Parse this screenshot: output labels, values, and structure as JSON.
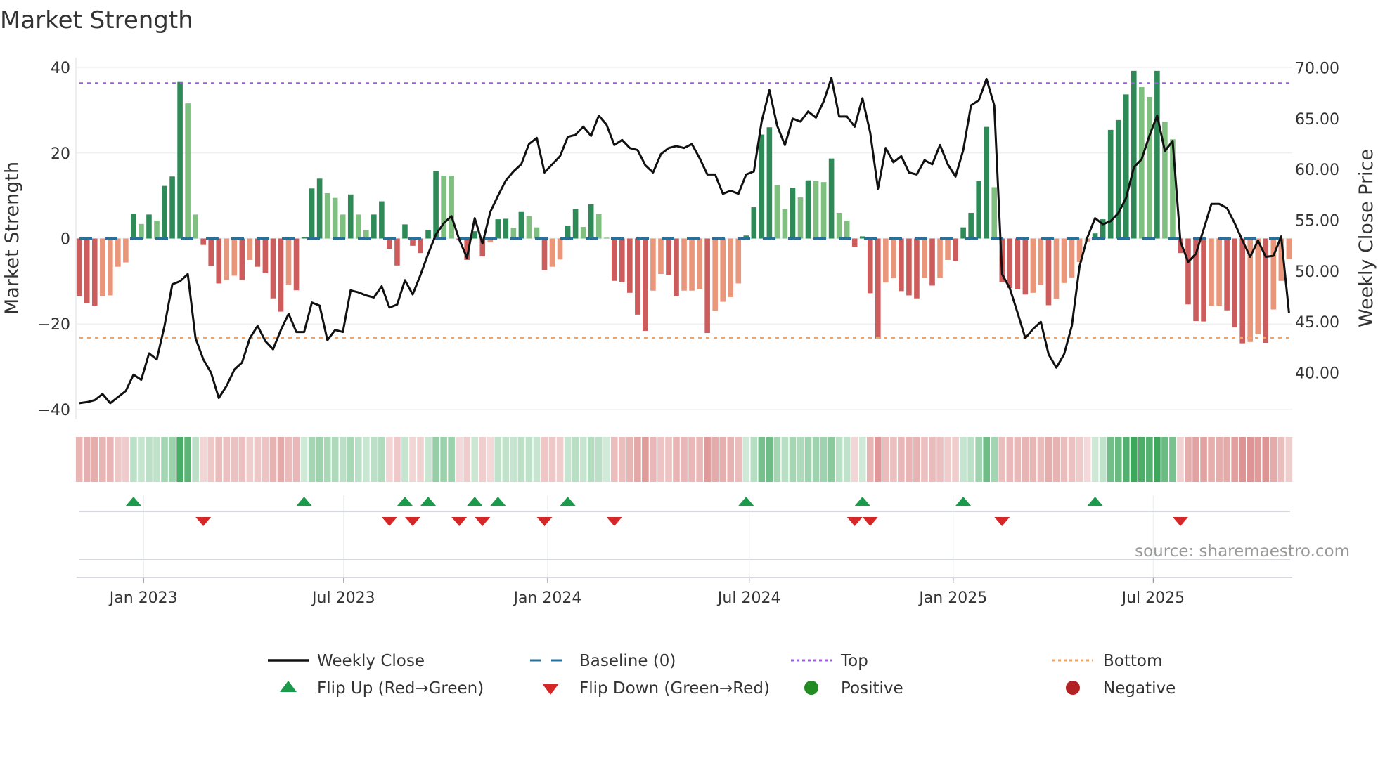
{
  "title": "Market Strength",
  "source": "source: sharemaestro.com",
  "colors": {
    "bar_pos_strong": "#2e8b57",
    "bar_pos_weak": "#7fbf7f",
    "bar_neg_strong": "#cd5c5c",
    "bar_neg_weak": "#e9967a",
    "baseline": "#2a6f97",
    "top": "#9b5de5",
    "bottom": "#f4a261",
    "line": "#111111",
    "flip_up": "#1a9a4a",
    "flip_down": "#d62728",
    "positive": "#228b22",
    "negative": "#b22222"
  },
  "legend": [
    {
      "label": "Weekly Close",
      "icon": "solid-line"
    },
    {
      "label": "Baseline (0)",
      "icon": "dashed-line"
    },
    {
      "label": "Top",
      "icon": "dotted-line"
    },
    {
      "label": "Bottom",
      "icon": "dotted-line"
    },
    {
      "label": "Flip Up (Red→Green)",
      "icon": "triangle-up"
    },
    {
      "label": "Flip Down (Green→Red)",
      "icon": "triangle-down"
    },
    {
      "label": "Positive",
      "icon": "circle"
    },
    {
      "label": "Negative",
      "icon": "circle"
    }
  ],
  "chart_data": {
    "type": "bar",
    "title": "Market Strength",
    "ylabel": "Market Strength",
    "y2label": "Weekly Close Price",
    "ylim": [
      -42.3,
      42.3
    ],
    "y2lim": [
      35.4,
      71.0
    ],
    "yticks": [
      "40",
      "20",
      "0",
      "−20",
      "−40"
    ],
    "ytick_values": [
      40,
      20,
      0,
      -20,
      -40
    ],
    "y2ticks": [
      "70.00",
      "65.00",
      "60.00",
      "55.00",
      "50.00",
      "45.00",
      "40.00"
    ],
    "y2tick_values": [
      70,
      65,
      60,
      55,
      50,
      45,
      40
    ],
    "xticks": [
      {
        "label": "Jan 2023",
        "week": 8.3
      },
      {
        "label": "Jul 2023",
        "week": 34.1
      },
      {
        "label": "Jan 2024",
        "week": 60.4
      },
      {
        "label": "Jul 2024",
        "week": 86.4
      },
      {
        "label": "Jan 2025",
        "week": 112.7
      },
      {
        "label": "Jul 2025",
        "week": 138.5
      }
    ],
    "top_level": 36.3,
    "bottom_level": -23.2,
    "baseline": 0,
    "strength": [
      -13.5,
      -15.2,
      -15.7,
      -13.5,
      -13.3,
      -6.6,
      -5.6,
      5.8,
      3.4,
      5.6,
      4.2,
      12.3,
      14.5,
      36.6,
      31.6,
      5.6,
      -1.5,
      -6.4,
      -10.5,
      -9.7,
      -8.7,
      -9.7,
      -5.0,
      -6.6,
      -8.1,
      -14.0,
      -17.1,
      -10.9,
      -12.1,
      0.4,
      11.7,
      14.0,
      10.6,
      9.5,
      5.6,
      10.3,
      5.6,
      2.0,
      5.6,
      8.7,
      -2.4,
      -6.3,
      3.3,
      -1.7,
      -3.4,
      2.0,
      15.8,
      14.7,
      14.7,
      -0.3,
      -5.0,
      1.7,
      -4.2,
      -0.9,
      4.5,
      4.6,
      2.5,
      6.2,
      5.2,
      2.6,
      -7.4,
      -6.6,
      -4.9,
      3.0,
      6.9,
      2.7,
      8.0,
      5.7,
      0.2,
      -9.9,
      -10.1,
      -12.7,
      -17.8,
      -21.6,
      -12.2,
      -8.3,
      -8.5,
      -13.4,
      -12.2,
      -12.2,
      -11.8,
      -22.1,
      -16.9,
      -14.8,
      -13.7,
      -10.5,
      0.7,
      7.3,
      24.3,
      26.0,
      12.5,
      6.9,
      11.9,
      9.6,
      13.6,
      13.4,
      13.2,
      18.7,
      6.0,
      4.2,
      -1.9,
      0.5,
      -12.8,
      -23.4,
      -10.3,
      -9.3,
      -12.3,
      -13.3,
      -14.0,
      -9.2,
      -11.0,
      -9.2,
      -5.0,
      -5.2,
      2.6,
      6.0,
      13.4,
      26.1,
      12.0,
      -10.2,
      -11.6,
      -11.9,
      -13.1,
      -12.7,
      -10.9,
      -15.6,
      -14.1,
      -10.4,
      -9.1,
      -5.5,
      -0.7,
      1.2,
      4.5,
      25.4,
      27.7,
      33.7,
      39.2,
      35.4,
      33.1,
      39.2,
      27.3,
      23.2,
      -3.4,
      -15.4,
      -19.3,
      -19.4,
      -15.7,
      -15.7,
      -16.8,
      -20.8,
      -24.5,
      -24.2,
      -22.4,
      -24.4,
      -16.6,
      -9.9,
      -4.8
    ],
    "weekly_close": [
      37.0,
      37.1,
      37.3,
      37.9,
      37.0,
      37.6,
      38.2,
      39.8,
      39.3,
      41.9,
      41.3,
      44.6,
      48.7,
      49.0,
      49.7,
      43.4,
      41.3,
      40.0,
      37.5,
      38.7,
      40.3,
      41.0,
      43.4,
      44.6,
      43.1,
      42.3,
      44.2,
      45.8,
      44.0,
      44.0,
      46.9,
      46.6,
      43.2,
      44.2,
      44.0,
      48.1,
      47.9,
      47.6,
      47.4,
      48.5,
      46.4,
      46.7,
      49.1,
      47.7,
      49.6,
      51.7,
      53.6,
      54.7,
      55.4,
      53.1,
      51.3,
      55.2,
      52.7,
      55.8,
      57.4,
      58.9,
      59.8,
      60.5,
      62.5,
      63.1,
      59.7,
      60.5,
      61.3,
      63.2,
      63.4,
      64.2,
      63.3,
      65.3,
      64.4,
      62.4,
      62.9,
      62.1,
      61.9,
      60.4,
      59.7,
      61.5,
      62.1,
      62.3,
      62.1,
      62.5,
      61.1,
      59.5,
      59.5,
      57.6,
      57.9,
      57.6,
      59.5,
      59.8,
      64.7,
      67.8,
      64.3,
      62.4,
      65.0,
      64.7,
      65.7,
      65.1,
      66.7,
      69.0,
      65.2,
      65.2,
      64.2,
      67.0,
      63.6,
      58.1,
      62.1,
      60.7,
      61.3,
      59.7,
      59.5,
      60.9,
      60.5,
      62.4,
      60.5,
      59.3,
      61.9,
      66.3,
      66.8,
      68.9,
      66.3,
      49.7,
      48.3,
      45.9,
      43.4,
      44.3,
      45.0,
      41.8,
      40.5,
      41.8,
      44.6,
      50.5,
      53.3,
      55.2,
      54.6,
      54.9,
      55.7,
      57.2,
      60.2,
      61.0,
      63.3,
      65.3,
      61.8,
      62.8,
      52.9,
      50.9,
      51.7,
      54.1,
      56.6,
      56.6,
      56.2,
      54.7,
      53.0,
      51.4,
      53.0,
      51.4,
      51.5,
      53.4,
      45.9
    ]
  }
}
